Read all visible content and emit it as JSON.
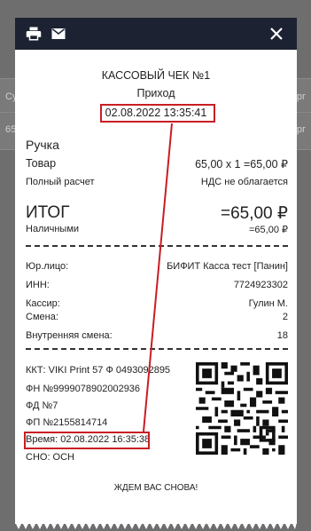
{
  "background": {
    "row1_left": "Су",
    "row1_right": "орг",
    "row2_left": "65",
    "row2_right": "орг"
  },
  "toolbar": {
    "print_icon": "printer-icon",
    "mail_icon": "mail-icon",
    "close_icon": "close-icon"
  },
  "receipt": {
    "title": "КАССОВЫЙ ЧЕК №1",
    "type": "Приход",
    "datetime": "02.08.2022 13:35:41",
    "item_name": "Ручка",
    "item_label": "Товар",
    "item_calc": "65,00 х 1 =65,00 ₽",
    "payment_method": "Полный расчет",
    "vat": "НДС не облагается",
    "total_label": "ИТОГ",
    "total_value": "=65,00 ₽",
    "cash_label": "Наличными",
    "cash_value": "=65,00 ₽",
    "legal_label": "Юр.лицо:",
    "legal_value": "БИФИТ Касса тест [Панин]",
    "inn_label": "ИНН:",
    "inn_value": "7724923302",
    "cashier_label": "Кассир:",
    "cashier_value": "Гулин М.",
    "shift_label": "Смена:",
    "shift_value": "2",
    "inner_shift_label": "Внутренняя смена:",
    "inner_shift_value": "18",
    "kkt": "ККТ: VIKI Print 57 Ф 0493092895",
    "fn": "ФН №9999078902002936",
    "fd": "ФД №7",
    "fp": "ФП №2155814714",
    "time": "Время: 02.08.2022 16:35:38",
    "sno": "СНО: ОСН",
    "footer": "ЖДЕМ ВАС СНОВА!"
  },
  "colors": {
    "header_bg": "#1c2231",
    "highlight": "#c81e24"
  }
}
